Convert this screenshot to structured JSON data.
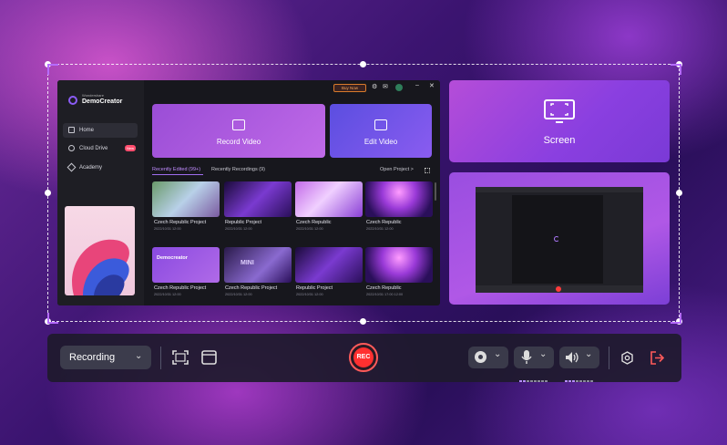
{
  "app": {
    "brand_top": "Wondershare",
    "brand_name": "DemoCreator",
    "buy_now": "Buy Now",
    "sidebar": [
      {
        "label": "Home"
      },
      {
        "label": "Cloud Drive",
        "badge": "New"
      },
      {
        "label": "Academy"
      }
    ],
    "record_video": "Record Video",
    "edit_video": "Edit Video",
    "tab_recent_edited": "Recently Edited (99+)",
    "tab_recent_recordings": "Recently Recordings (9)",
    "open_project": "Open Project >",
    "projects": [
      {
        "title": "Czech Republic Project",
        "date": "2022/10/31 12:00"
      },
      {
        "title": "Republic Project",
        "date": "2022/10/31 12:00"
      },
      {
        "title": "Czech Republic",
        "date": "2022/10/31 12:00"
      },
      {
        "title": "Czech Republic",
        "date": "2022/10/31 12:00"
      },
      {
        "title": "Czech Republic Project",
        "date": "2022/10/31 12:00"
      },
      {
        "title": "Czech Republic Project",
        "date": "2022/10/31 12:00"
      },
      {
        "title": "Republic Project",
        "date": "2022/10/31 12:00"
      },
      {
        "title": "Czech Republic",
        "date": "2022/10/31 17:00  12:00"
      }
    ],
    "thumb_text_democreator": "Democreator",
    "thumb_text_mini": "MINI"
  },
  "screen_panel": {
    "label": "Screen"
  },
  "toolbar": {
    "mode": "Recording",
    "rec": "REC"
  },
  "colors": {
    "accent": "#8b5cf6",
    "rec": "#ff3b3b"
  }
}
